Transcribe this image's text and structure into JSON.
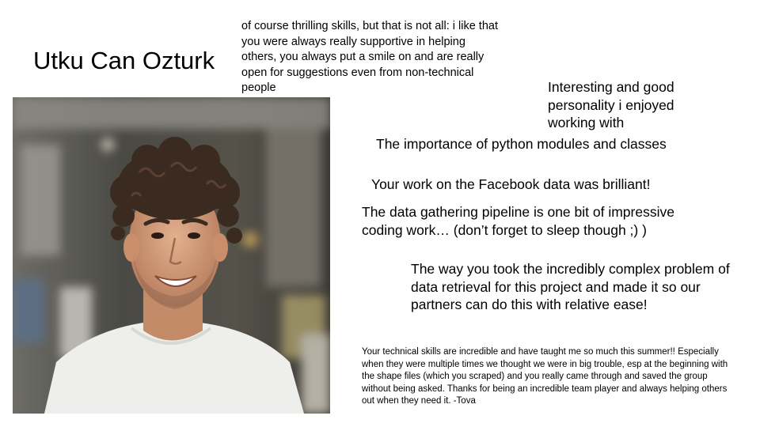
{
  "slide": {
    "title": "Utku Can Ozturk",
    "photo_alt": "Portrait of a smiling man with curly hair wearing a white t-shirt",
    "comments": [
      "of course thrilling skills, but that is not all: i like that you were always really supportive in helping others, you always put a smile on and are really open for suggestions even from non-technical people",
      "Interesting and good personality i enjoyed working with",
      "The importance of python modules and classes",
      "Your work on the Facebook data was brilliant!",
      "The data gathering pipeline is one bit of impressive coding work… (don’t forget to sleep though ;) )",
      "The way you took the incredibly complex problem of data retrieval for this project and made it so our partners can do this with relative ease!",
      "Your technical skills are incredible and have taught me so much this summer!! Especially when they were multiple times we thought we were in big trouble, esp at the beginning with the shape files (which you scraped) and you really came through and saved the group without being asked. Thanks for being an incredible team player and always helping others out when they need it. -Tova"
    ]
  }
}
